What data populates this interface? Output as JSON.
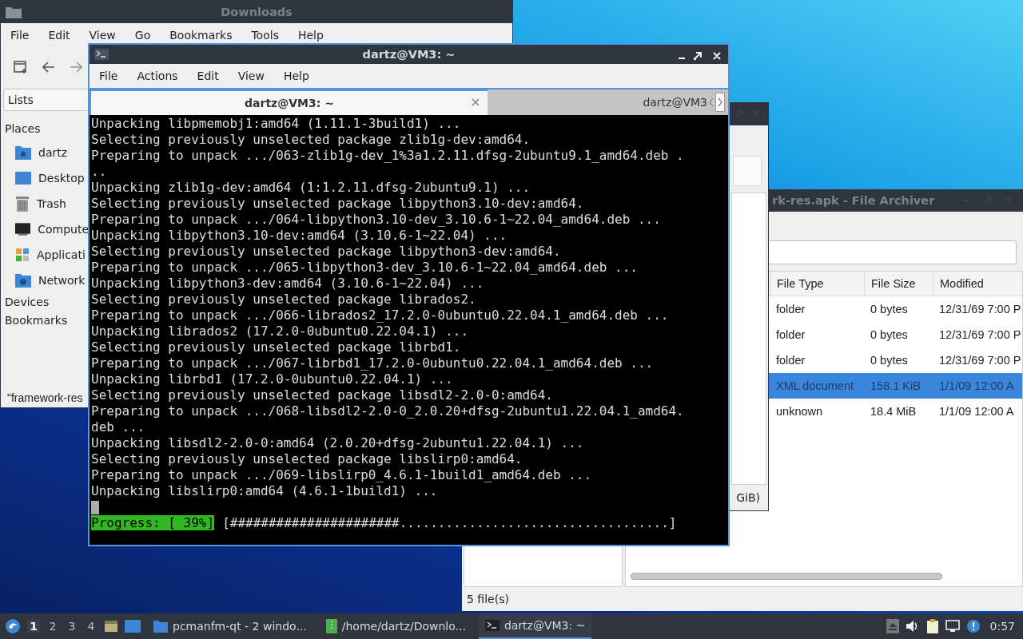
{
  "file_manager": {
    "title": "Downloads",
    "menu": [
      "File",
      "Edit",
      "View",
      "Go",
      "Bookmarks",
      "Tools",
      "Help"
    ],
    "sidebar_mode": "Lists",
    "places_heading": "Places",
    "places": [
      {
        "label": "dartz",
        "kind": "home"
      },
      {
        "label": "Desktop",
        "kind": "desktop"
      },
      {
        "label": "Trash",
        "kind": "trash"
      },
      {
        "label": "Compute",
        "kind": "computer"
      },
      {
        "label": "Applicati",
        "kind": "apps"
      },
      {
        "label": "Network",
        "kind": "network"
      }
    ],
    "sections": [
      "Devices",
      "Bookmarks"
    ],
    "status": "\"framework-res"
  },
  "archiver": {
    "title": "rk-res.apk - File Archiver",
    "columns": [
      "File Type",
      "File Size",
      "Modified"
    ],
    "rows": [
      {
        "cells": [
          "folder",
          "0 bytes",
          "12/31/69 7:00 P"
        ],
        "selected": false
      },
      {
        "cells": [
          "folder",
          "0 bytes",
          "12/31/69 7:00 P"
        ],
        "selected": false
      },
      {
        "cells": [
          "folder",
          "0 bytes",
          "12/31/69 7:00 P"
        ],
        "selected": false
      },
      {
        "cells": [
          "XML document",
          "158.1 KiB",
          "1/1/09 12:00 A"
        ],
        "selected": true
      },
      {
        "cells": [
          "unknown",
          "18.4 MiB",
          "1/1/09 12:00 A"
        ],
        "selected": false
      }
    ],
    "status": "5 file(s)"
  },
  "dialog": {
    "status": "GiB)"
  },
  "terminal": {
    "title": "dartz@VM3: ~",
    "menu": [
      "File",
      "Actions",
      "Edit",
      "View",
      "Help"
    ],
    "tabs": [
      {
        "label": "dartz@VM3: ~",
        "selected": true
      },
      {
        "label": "dartz@VM3",
        "selected": false
      }
    ],
    "lines": [
      "Unpacking libpmemobj1:amd64 (1.11.1-3build1) ...",
      "Selecting previously unselected package zlib1g-dev:amd64.",
      "Preparing to unpack .../063-zlib1g-dev_1%3a1.2.11.dfsg-2ubuntu9.1_amd64.deb .",
      "..",
      "Unpacking zlib1g-dev:amd64 (1:1.2.11.dfsg-2ubuntu9.1) ...",
      "Selecting previously unselected package libpython3.10-dev:amd64.",
      "Preparing to unpack .../064-libpython3.10-dev_3.10.6-1~22.04_amd64.deb ...",
      "Unpacking libpython3.10-dev:amd64 (3.10.6-1~22.04) ...",
      "Selecting previously unselected package libpython3-dev:amd64.",
      "Preparing to unpack .../065-libpython3-dev_3.10.6-1~22.04_amd64.deb ...",
      "Unpacking libpython3-dev:amd64 (3.10.6-1~22.04) ...",
      "Selecting previously unselected package librados2.",
      "Preparing to unpack .../066-librados2_17.2.0-0ubuntu0.22.04.1_amd64.deb ...",
      "Unpacking librados2 (17.2.0-0ubuntu0.22.04.1) ...",
      "Selecting previously unselected package librbd1.",
      "Preparing to unpack .../067-librbd1_17.2.0-0ubuntu0.22.04.1_amd64.deb ...",
      "Unpacking librbd1 (17.2.0-0ubuntu0.22.04.1) ...",
      "Selecting previously unselected package libsdl2-2.0-0:amd64.",
      "Preparing to unpack .../068-libsdl2-2.0-0_2.0.20+dfsg-2ubuntu1.22.04.1_amd64.",
      "deb ...",
      "Unpacking libsdl2-2.0-0:amd64 (2.0.20+dfsg-2ubuntu1.22.04.1) ...",
      "Selecting previously unselected package libslirp0:amd64.",
      "Preparing to unpack .../069-libslirp0_4.6.1-1build1_amd64.deb ...",
      "Unpacking libslirp0:amd64 (4.6.1-1build1) ..."
    ],
    "progress_label": "Progress: [ 39%]",
    "progress_bar": "[######################...................................]"
  },
  "taskbar": {
    "workspaces": [
      {
        "label": "1",
        "selected": true
      },
      {
        "label": "2",
        "selected": false
      },
      {
        "label": "3",
        "selected": false
      },
      {
        "label": "4",
        "selected": false
      }
    ],
    "tasks": [
      {
        "label": "pcmanfm-qt - 2 windo...",
        "kind": "folder",
        "selected": false
      },
      {
        "label": "/home/dartz/Downlo...",
        "kind": "archive",
        "selected": false
      },
      {
        "label": "dartz@VM3: ~",
        "kind": "terminal",
        "selected": true
      }
    ],
    "clock": "0:57"
  }
}
